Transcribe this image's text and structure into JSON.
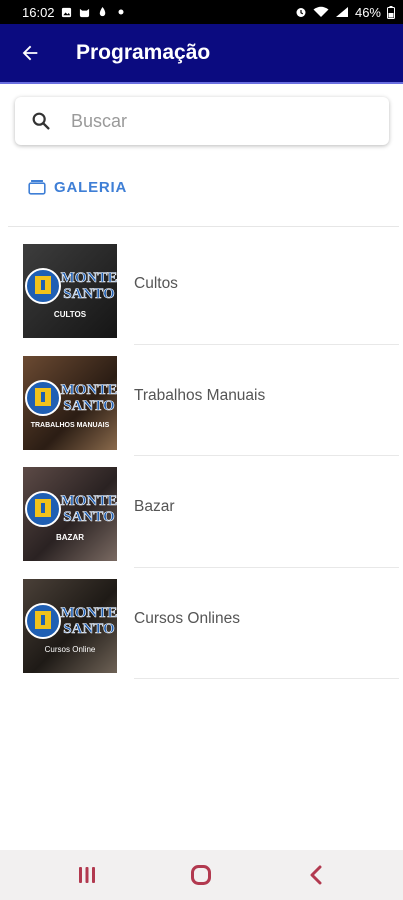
{
  "status_bar": {
    "time": "16:02",
    "battery": "46%",
    "left_icons": [
      "gallery-icon",
      "cat-icon",
      "flame-icon",
      "dot-icon"
    ],
    "right_icons": [
      "alarm-icon",
      "wifi-icon",
      "signal-icon"
    ]
  },
  "app_bar": {
    "title": "Programação",
    "background": "#0b0b80"
  },
  "search": {
    "placeholder": "Buscar"
  },
  "gallery": {
    "label": "GALERIA",
    "color": "#3f7fd6"
  },
  "items": [
    {
      "label": "Cultos",
      "thumb_caption": "CULTOS",
      "thumb_brand": "MONTE SANTO"
    },
    {
      "label": "Trabalhos Manuais",
      "thumb_caption": "TRABALHOS MANUAIS",
      "thumb_brand": "MONTE SANTO"
    },
    {
      "label": "Bazar",
      "thumb_caption": "BAZAR",
      "thumb_brand": "MONTE SANTO"
    },
    {
      "label": "Cursos Onlines",
      "thumb_caption": "Cursos Online",
      "thumb_brand": "MONTE SANTO"
    }
  ],
  "nav": {
    "buttons": [
      "recent-apps",
      "home",
      "back"
    ],
    "color": "#b2394f"
  }
}
